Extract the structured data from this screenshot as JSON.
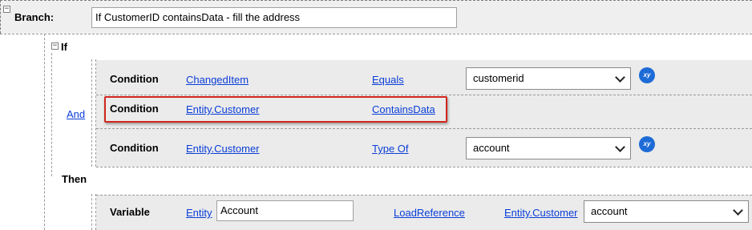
{
  "branch": {
    "label": "Branch:",
    "description": "If CustomerID containsData - fill the address",
    "toggle": "−"
  },
  "if_block": {
    "label": "If",
    "toggle": "−",
    "operator": "And",
    "conditions": [
      {
        "label": "Condition",
        "field": "ChangedItem",
        "operator": "Equals",
        "value": "customerid",
        "has_value_select": true
      },
      {
        "label": "Condition",
        "field": "Entity.Customer",
        "operator": "ContainsData"
      },
      {
        "label": "Condition",
        "field": "Entity.Customer",
        "operator": "Type Of",
        "value": "account",
        "has_value_select": true
      }
    ],
    "xy_icon": "xy"
  },
  "then_block": {
    "label": "Then",
    "action": {
      "label": "Variable",
      "type_link": "Entity",
      "name_value": "Account",
      "function": "LoadReference",
      "source": "Entity.Customer",
      "target": "account"
    }
  },
  "colors": {
    "link": "#0a3ed8",
    "highlight": "#d0261d",
    "xy_icon": "#1d6bd6"
  }
}
